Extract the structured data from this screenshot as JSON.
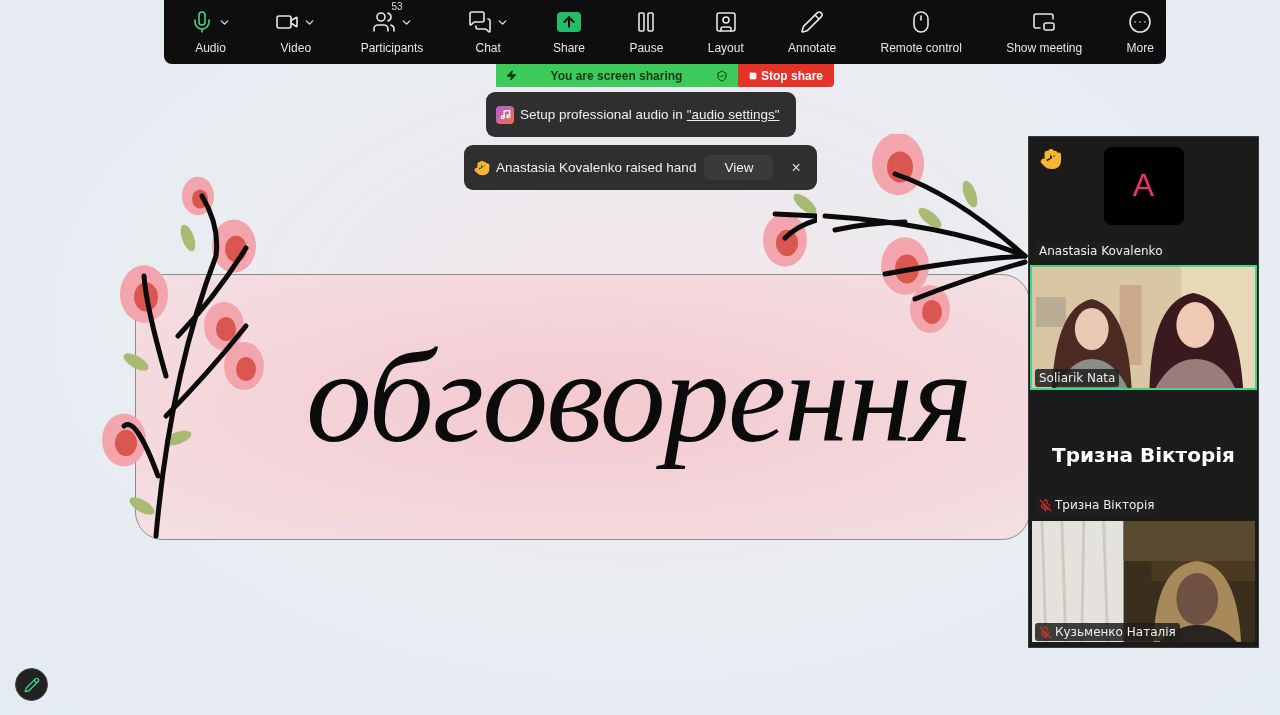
{
  "toolbar": {
    "items": [
      {
        "kind": "audio",
        "label": "Audio",
        "caret": true,
        "on": true
      },
      {
        "kind": "video",
        "label": "Video",
        "caret": true
      },
      {
        "kind": "participants",
        "label": "Participants",
        "caret": true,
        "badge": "53"
      },
      {
        "kind": "chat",
        "label": "Chat",
        "caret": true
      },
      {
        "kind": "share",
        "label": "Share",
        "caret": false
      },
      {
        "kind": "pause",
        "label": "Pause",
        "caret": false
      },
      {
        "kind": "layout",
        "label": "Layout",
        "caret": false
      },
      {
        "kind": "annotate",
        "label": "Annotate",
        "caret": false
      },
      {
        "kind": "remote",
        "label": "Remote control",
        "caret": false
      },
      {
        "kind": "show",
        "label": "Show meeting",
        "caret": false
      },
      {
        "kind": "more",
        "label": "More",
        "caret": false
      }
    ]
  },
  "sharing_bar": {
    "status": "You are screen sharing",
    "stop": "Stop share"
  },
  "audio_tip": {
    "text": "Setup professional audio in",
    "link": "\"audio settings\""
  },
  "hand_notice": {
    "text": "Anastasia Kovalenko raised hand",
    "button": "View",
    "close": "×"
  },
  "slide": {
    "title": "обговорення"
  },
  "gallery": {
    "tiles": [
      {
        "kind": "avatar",
        "initial": "A",
        "name": "Anastasia Kovalenko",
        "raised_hand": true,
        "muted": false,
        "speaking": false
      },
      {
        "kind": "video",
        "name": "Soliarik Nata",
        "raised_hand": false,
        "muted": false,
        "speaking": true
      },
      {
        "kind": "name",
        "big_name": "Тризна Вікторія",
        "name": "Тризна Вікторія",
        "raised_hand": false,
        "muted": true,
        "speaking": false
      },
      {
        "kind": "video",
        "name": "Кузьменко Наталія",
        "raised_hand": false,
        "muted": true,
        "speaking": false
      }
    ]
  }
}
